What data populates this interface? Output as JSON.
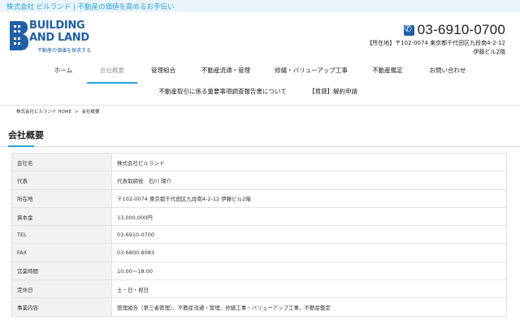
{
  "topbar": {
    "text": "株式会社 ビルランド | 不動産の価値を高めるお手伝い"
  },
  "logo": {
    "line1": "BUILDING",
    "line2": "AND LAND",
    "tagline": "不動産の価値を探求する"
  },
  "contact": {
    "phone": "03-6910-0700",
    "address_line1": "【所在地】〒102-0074 東京都千代田区九段南4-2-12",
    "address_line2": "伊藤ビル2階"
  },
  "nav": {
    "row1": [
      "ホーム",
      "会社概要",
      "管理組合",
      "不動産流通・管理",
      "修繕・バリューアップ工事",
      "不動産鑑定",
      "お問い合わせ"
    ],
    "row2": [
      "不動産取引に係る重要事項調査報告書について",
      "【賃貸】解約申請"
    ],
    "active": "会社概要"
  },
  "breadcrumb": {
    "home": "株式会社ビルランド HOME",
    "separator": ">",
    "current": "会社概要"
  },
  "page": {
    "title": "会社概要"
  },
  "company_table": [
    {
      "key": "会社名",
      "value": "株式会社ビルランド"
    },
    {
      "key": "代表",
      "value": "代表取締役　石川 陽介"
    },
    {
      "key": "所在地",
      "value": "〒102-0074 東京都千代田区九段南4-2-12 伊藤ビル2階"
    },
    {
      "key": "資本金",
      "value": "13,000,000円"
    },
    {
      "key": "TEL",
      "value": "03-6910-0700"
    },
    {
      "key": "FAX",
      "value": "03-6800-8083"
    },
    {
      "key": "営業時間",
      "value": "10:00〜18:00"
    },
    {
      "key": "定休日",
      "value": "土・日・祝日"
    },
    {
      "key": "事業内容",
      "value": "管理組合（第三者管理）、不動産流通・管理、修繕工事・バリューアップ工事、不動産鑑定"
    }
  ],
  "colors": {
    "accent": "#29a3dd",
    "brand": "#1f5fa8",
    "topbar_bg": "#eaf4fb",
    "table_key_bg": "#f2f2f2"
  },
  "icons": {
    "phone": "phone-icon",
    "logo": "building-logo-icon"
  }
}
